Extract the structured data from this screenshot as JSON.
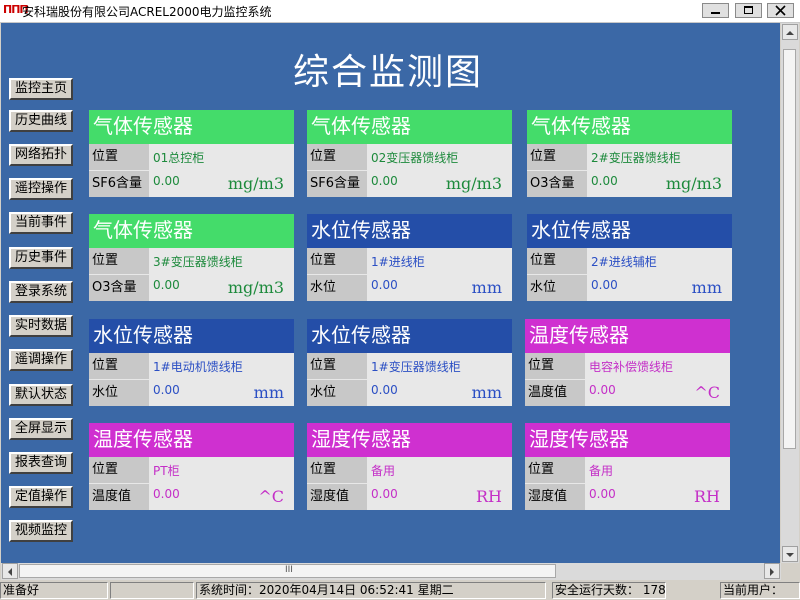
{
  "app": {
    "title": "安科瑞股份有限公司ACREL2000电力监控系统"
  },
  "page": {
    "title": "综合监测图"
  },
  "nav": [
    "监控主页",
    "历史曲线",
    "网络拓扑",
    "遥控操作",
    "当前事件",
    "历史事件",
    "登录系统",
    "实时数据",
    "遥调操作",
    "默认状态",
    "全屏显示",
    "报表查询",
    "定值操作",
    "视频监控"
  ],
  "cards": [
    {
      "title": "气体传感器",
      "pos_label": "位置",
      "pos": "01总控柜",
      "val_label": "SF6含量",
      "value": "0.00",
      "unit": "mg/m3"
    },
    {
      "title": "气体传感器",
      "pos_label": "位置",
      "pos": "02变压器馈线柜",
      "val_label": "SF6含量",
      "value": "0.00",
      "unit": "mg/m3"
    },
    {
      "title": "气体传感器",
      "pos_label": "位置",
      "pos": "2#变压器馈线柜",
      "val_label": "O3含量",
      "value": "0.00",
      "unit": "mg/m3"
    },
    {
      "title": "气体传感器",
      "pos_label": "位置",
      "pos": "3#变压器馈线柜",
      "val_label": "O3含量",
      "value": "0.00",
      "unit": "mg/m3"
    },
    {
      "title": "水位传感器",
      "pos_label": "位置",
      "pos": "1#进线柜",
      "val_label": "水位",
      "value": "0.00",
      "unit": "mm"
    },
    {
      "title": "水位传感器",
      "pos_label": "位置",
      "pos": "2#进线辅柜",
      "val_label": "水位",
      "value": "0.00",
      "unit": "mm"
    },
    {
      "title": "水位传感器",
      "pos_label": "位置",
      "pos": "1#电动机馈线柜",
      "val_label": "水位",
      "value": "0.00",
      "unit": "mm"
    },
    {
      "title": "水位传感器",
      "pos_label": "位置",
      "pos": "1#变压器馈线柜",
      "val_label": "水位",
      "value": "0.00",
      "unit": "mm"
    },
    {
      "title": "温度传感器",
      "pos_label": "位置",
      "pos": "电容补偿馈线柜",
      "val_label": "温度值",
      "value": "0.00",
      "unit": "^C"
    },
    {
      "title": "温度传感器",
      "pos_label": "位置",
      "pos": "PT柜",
      "val_label": "温度值",
      "value": "0.00",
      "unit": "^C"
    },
    {
      "title": "湿度传感器",
      "pos_label": "位置",
      "pos": "备用",
      "val_label": "湿度值",
      "value": "0.00",
      "unit": "RH"
    },
    {
      "title": "湿度传感器",
      "pos_label": "位置",
      "pos": "备用",
      "val_label": "湿度值",
      "value": "0.00",
      "unit": "RH"
    }
  ],
  "scroll": {
    "grip": "III"
  },
  "status": {
    "ready": "准备好",
    "time": "系统时间：2020年04月14日   06:52:41   星期二",
    "safe_days": "安全运行天数：  178",
    "user": "当前用户："
  },
  "colors": {
    "gas": "#44dc6a",
    "water": "#244ea8",
    "temp": "#cf30d0",
    "background": "#3b68a6"
  }
}
